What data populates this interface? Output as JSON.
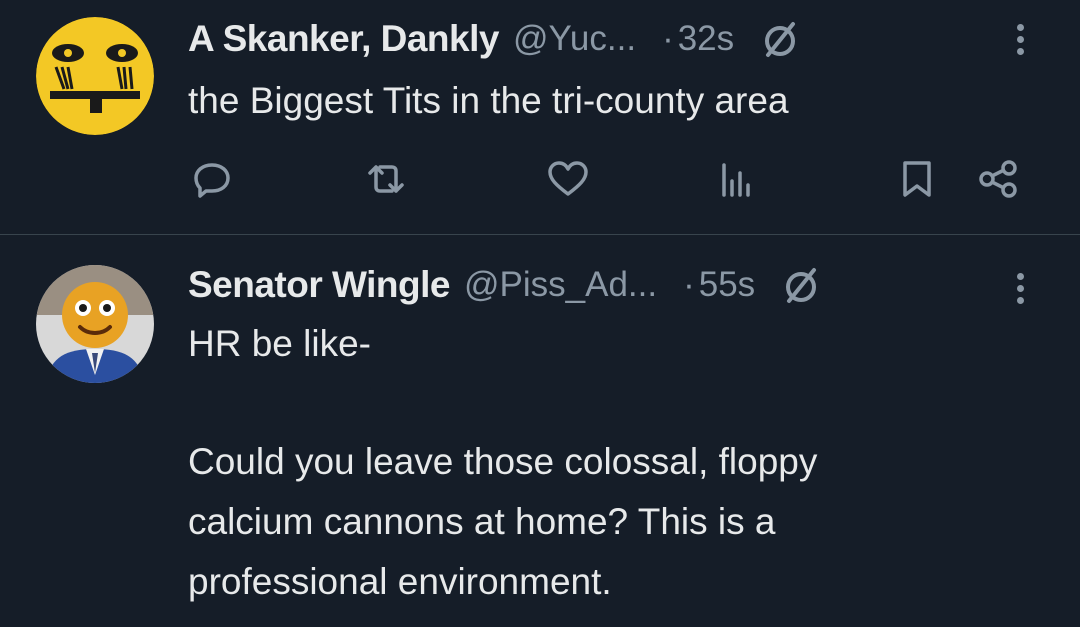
{
  "tweets": [
    {
      "display_name": "A Skanker, Dankly",
      "handle": "@Yuc...",
      "dot": "·",
      "time": "32s",
      "text": "the Biggest Tits in the tri-county area",
      "avatar_icon": "face-emoji-icon"
    },
    {
      "display_name": "Senator Wingle",
      "handle": "@Piss_Ad...",
      "dot": "·",
      "time": "55s",
      "lines": [
        "HR be like-",
        "",
        "Could you leave those colossal, floppy",
        "calcium cannons at home? This is a",
        "professional environment."
      ],
      "avatar_icon": "emoji-man-in-suit-icon"
    }
  ],
  "icons": {
    "reply": "reply-icon",
    "retweet": "retweet-icon",
    "like": "heart-icon",
    "views": "views-icon",
    "bookmark": "bookmark-icon",
    "share": "share-icon",
    "more": "more-icon",
    "verified": "slashed-circle-icon"
  },
  "colors": {
    "background": "#151d28",
    "text": "#e7e9ea",
    "secondary": "#8b98a5",
    "divider": "#38444d",
    "avatar_yellow": "#f3c825"
  }
}
